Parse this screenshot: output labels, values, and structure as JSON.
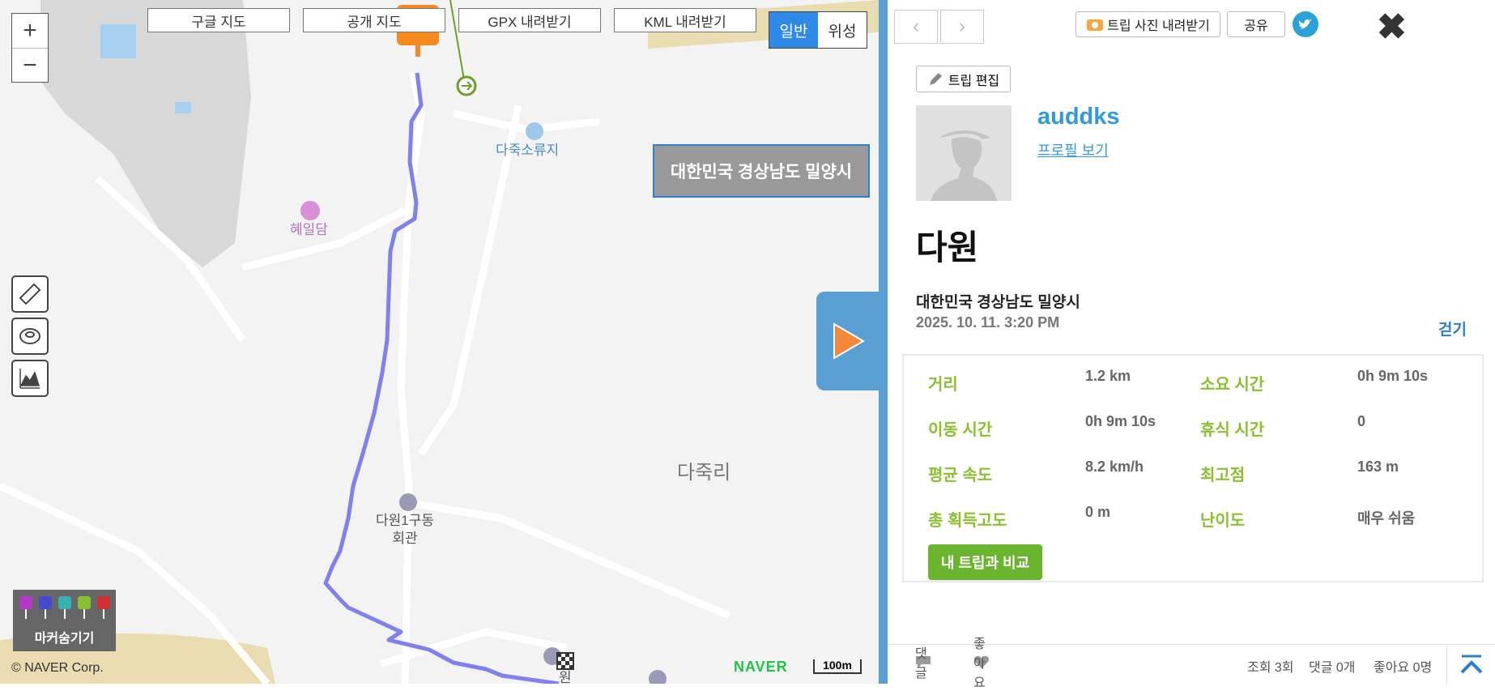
{
  "map": {
    "zoom_in": "+",
    "zoom_out": "−",
    "map_buttons": [
      "구글 지도",
      "공개 지도",
      "GPX 내려받기",
      "KML 내려받기"
    ],
    "view_toggle": {
      "normal": "일반",
      "satellite": "위성"
    },
    "location_box": "대한민국 경상남도 밀양시",
    "labels": {
      "reservoir": "다죽소류지",
      "poi": "혜일담",
      "village": "다죽리",
      "hall_line1": "다원1구동",
      "hall_line2": "회관",
      "end_fragment": "원"
    },
    "marker_toggle": "마커숨기기",
    "copyright": "© NAVER Corp.",
    "brand": "NAVER",
    "scale": "100m",
    "route_color": "#8080f0"
  },
  "panel": {
    "photo_download": "트립 사진 내려받기",
    "share": "공유",
    "edit": "트립 편집",
    "username": "auddks",
    "profile_link": "프로필 보기",
    "trip_title": "다원",
    "location": "대한민국 경상남도 밀양시",
    "datetime": "2025. 10. 11. 3:20 PM",
    "activity": "걷기",
    "stats": [
      {
        "label": "거리",
        "value": "1.2 km"
      },
      {
        "label": "소요 시간",
        "value": "0h 9m 10s"
      },
      {
        "label": "이동 시간",
        "value": "0h 9m 10s"
      },
      {
        "label": "휴식 시간",
        "value": "0"
      },
      {
        "label": "평균 속도",
        "value": "8.2 km/h"
      },
      {
        "label": "최고점",
        "value": "163 m"
      },
      {
        "label": "총 획득고도",
        "value": "0 m"
      },
      {
        "label": "난이도",
        "value": "매우 쉬움"
      }
    ],
    "compare_button": "내 트립과 비교",
    "footer": {
      "comment": "댓글",
      "like": "좋아요",
      "views": "조회 3회",
      "comments_count": "댓글 0개",
      "likes_count": "좋아요 0명"
    }
  }
}
